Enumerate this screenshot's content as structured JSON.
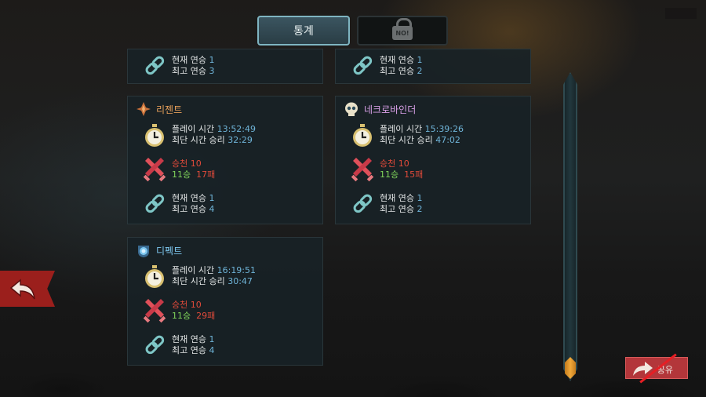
{
  "tabs": {
    "stats_label": "통계",
    "locked_badge": "NO!"
  },
  "panels": [
    {
      "key": "top_left",
      "current_streak_label": "현재 연승",
      "current_streak": "1",
      "best_streak_label": "최고 연승",
      "best_streak": "3"
    },
    {
      "key": "top_right",
      "current_streak_label": "현재 연승",
      "current_streak": "1",
      "best_streak_label": "최고 연승",
      "best_streak": "2"
    },
    {
      "key": "regent",
      "class_name": "리젠트",
      "class_color": "#e8a05a",
      "playtime_label": "플레이 시간",
      "playtime": "13:52:49",
      "fastest_label": "최단 시간 승리",
      "fastest": "32:29",
      "ascension_label": "승천",
      "ascension": "10",
      "wins": "11승",
      "losses": "17패",
      "current_streak_label": "현재 연승",
      "current_streak": "1",
      "best_streak_label": "최고 연승",
      "best_streak": "4"
    },
    {
      "key": "necrobinder",
      "class_name": "네크로바인더",
      "class_color": "#d9a0e8",
      "playtime_label": "플레이 시간",
      "playtime": "15:39:26",
      "fastest_label": "최단 시간 승리",
      "fastest": "47:02",
      "ascension_label": "승천",
      "ascension": "10",
      "wins": "11승",
      "losses": "15패",
      "current_streak_label": "현재 연승",
      "current_streak": "1",
      "best_streak_label": "최고 연승",
      "best_streak": "2"
    },
    {
      "key": "defect",
      "class_name": "디펙트",
      "class_color": "#7ec8f0",
      "playtime_label": "플레이 시간",
      "playtime": "16:19:51",
      "fastest_label": "최단 시간 승리",
      "fastest": "30:47",
      "ascension_label": "승천",
      "ascension": "10",
      "wins": "11승",
      "losses": "29패",
      "current_streak_label": "현재 연승",
      "current_streak": "1",
      "best_streak_label": "최고 연승",
      "best_streak": "4"
    }
  ],
  "buttons": {
    "share_label": "공유"
  },
  "colors": {
    "accent_blue": "#6fb4d8",
    "ascension_red": "#e04a3a",
    "wins_green": "#7fd35a",
    "scroll_thumb": "#f0a83a",
    "back_button": "#9b1f1c"
  }
}
